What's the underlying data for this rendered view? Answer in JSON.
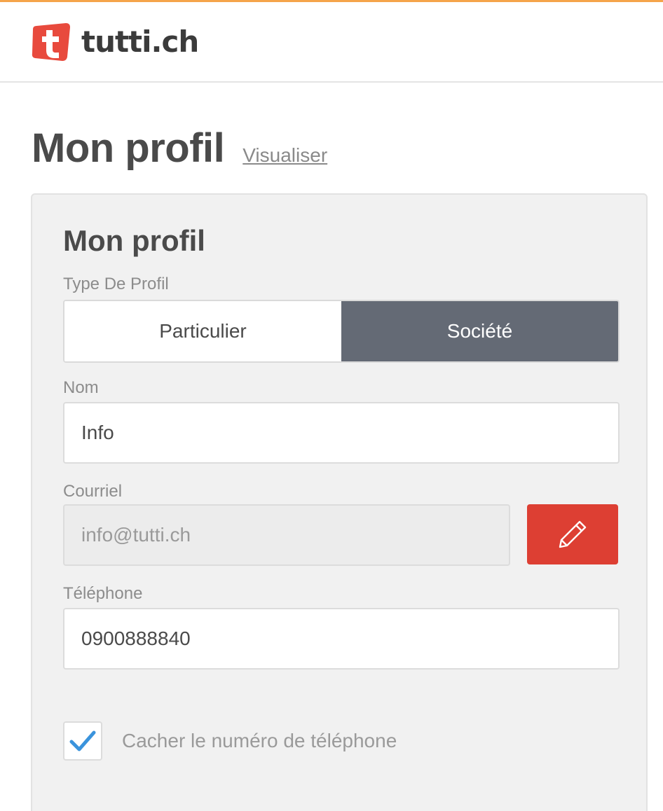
{
  "header": {
    "brand": "tutti.ch",
    "logo_icon": "tutti-logo-icon",
    "accent_color": "#f5a44a",
    "brand_color": "#e84a3d"
  },
  "page": {
    "title": "Mon profil",
    "view_link": "Visualiser"
  },
  "card": {
    "title": "Mon profil",
    "profile_type": {
      "label": "Type De Profil",
      "options": [
        "Particulier",
        "Société"
      ],
      "selected": "Société"
    },
    "name": {
      "label": "Nom",
      "value": "Info"
    },
    "email": {
      "label": "Courriel",
      "value": "info@tutti.ch",
      "edit_icon": "pencil-icon",
      "edit_color": "#dd3f33"
    },
    "phone": {
      "label": "Téléphone",
      "value": "0900888840"
    },
    "hide_phone": {
      "label": "Cacher le numéro de téléphone",
      "checked": true,
      "icon": "checkmark-icon"
    }
  }
}
